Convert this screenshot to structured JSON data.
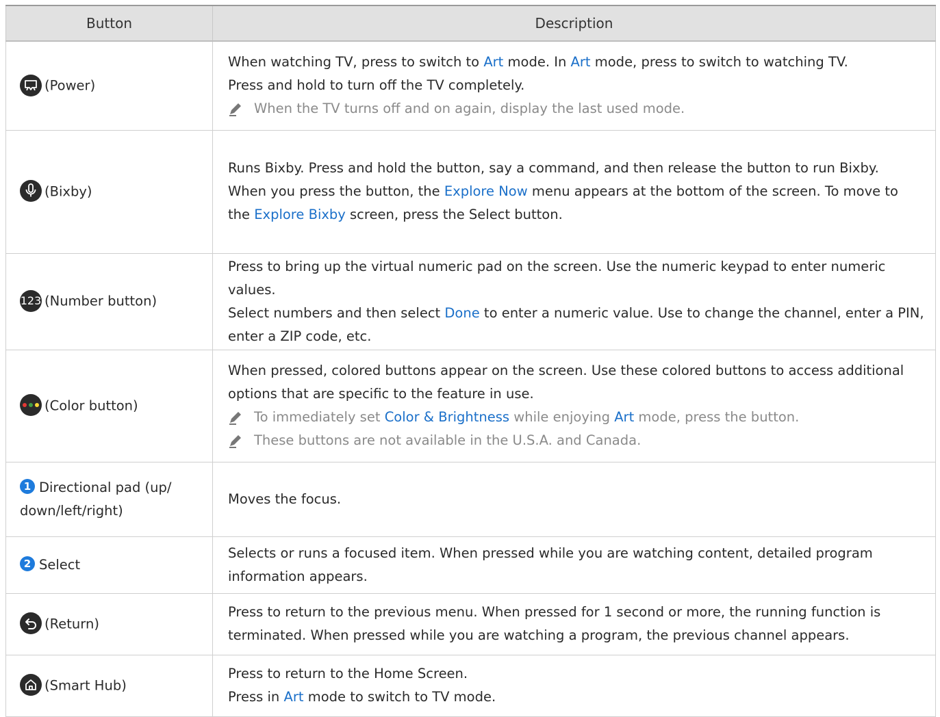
{
  "header": {
    "button": "Button",
    "description": "Description"
  },
  "rows": {
    "power": {
      "label": "(Power)",
      "d1a": "When watching TV, press to switch to ",
      "d1b": "Art",
      "d1c": " mode. In ",
      "d1d": "Art",
      "d1e": " mode, press to switch to watching TV.",
      "d2": "Press and hold to turn off the TV completely.",
      "note": "When the TV turns off and on again, display the last used mode."
    },
    "bixby": {
      "label": "(Bixby)",
      "d1": "Runs Bixby. Press and hold the button, say a command, and then release the button to run Bixby.",
      "d2a": "When you press the button, the ",
      "d2b": "Explore Now",
      "d2c": " menu appears at the bottom of the screen. To move to the ",
      "d2d": "Explore Bixby",
      "d2e": " screen, press the Select button."
    },
    "number": {
      "icon_text": "123",
      "label": "(Number button)",
      "d1": "Press to bring up the virtual numeric pad on the screen. Use the numeric keypad to enter numeric values.",
      "d2a": "Select numbers and then select ",
      "d2b": "Done",
      "d2c": " to enter a numeric value. Use to change the channel, enter a PIN, enter a ZIP code, etc."
    },
    "color": {
      "label": "(Color button)",
      "d1": "When pressed, colored buttons appear on the screen. Use these colored buttons to access additional options that are specific to the feature in use.",
      "n1a": "To immediately set ",
      "n1b": "Color & Brightness",
      "n1c": " while enjoying ",
      "n1d": "Art",
      "n1e": " mode, press the button.",
      "n2": "These buttons are not available in the U.S.A. and Canada."
    },
    "dpad": {
      "num": "1",
      "label": "Directional pad (up/ down/left/right)",
      "d1": "Moves the focus."
    },
    "select": {
      "num": "2",
      "label": "Select",
      "d1": "Selects or runs a focused item. When pressed while you are watching content, detailed program information appears."
    },
    "return": {
      "label": "(Return)",
      "d1": "Press to return to the previous menu. When pressed for 1 second or more, the running function is terminated. When pressed while you are watching a program, the previous channel appears."
    },
    "home": {
      "label": "(Smart Hub)",
      "d1": "Press to return to the Home Screen.",
      "d2a": "Press in ",
      "d2b": "Art",
      "d2c": " mode to switch to TV mode."
    }
  },
  "colors": {
    "highlight": "#1a6fc9",
    "icon": "#2b2b2b",
    "number_badge": "#1e7bdc",
    "note": "#8a8a8a"
  }
}
